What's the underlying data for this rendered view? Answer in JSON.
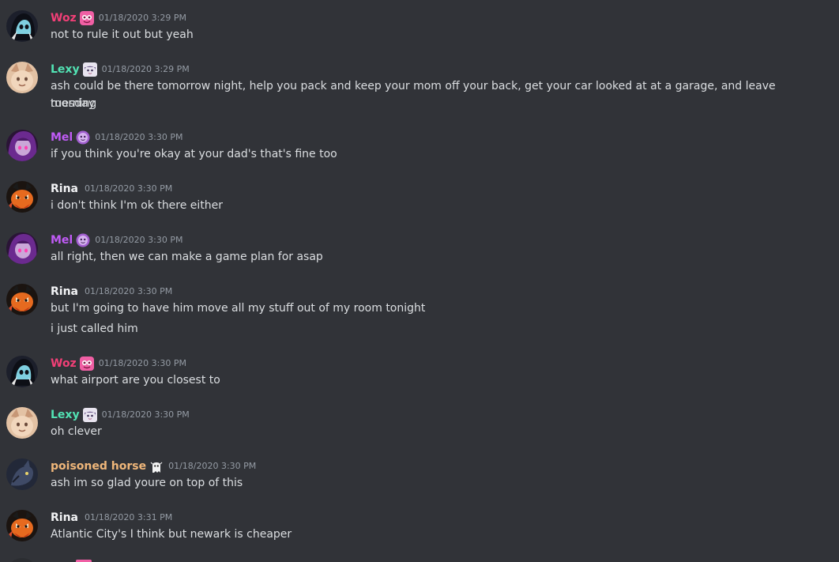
{
  "messages": [
    {
      "user": "Woz",
      "user_color": "#f23f77",
      "badge": "pink-creature-emoji",
      "avatar": "dark-hooded-face-avatar",
      "timestamp": "01/18/2020 3:29 PM",
      "lines": [
        "not to rule it out but yeah"
      ]
    },
    {
      "user": "Lexy",
      "user_color": "#52e3b4",
      "badge": "anime-girl-emoji",
      "avatar": "beige-fox-avatar",
      "timestamp": "01/18/2020 3:29 PM",
      "lines": [
        "ash could be there tomorrow night, help you pack and keep your mom off your back, get your car looked at at a garage, and leave tuesday",
        "morning"
      ]
    },
    {
      "user": "Mel",
      "user_color": "#c05bf6",
      "badge": "purple-face-emoji",
      "avatar": "purple-haired-girl-avatar",
      "timestamp": "01/18/2020 3:30 PM",
      "lines": [
        "if you think you're okay at your dad's that's fine too"
      ]
    },
    {
      "user": "Rina",
      "user_color": "#f2f3f5",
      "badge": "",
      "avatar": "orange-dragon-avatar",
      "timestamp": "01/18/2020 3:30 PM",
      "lines": [
        "i don't think I'm ok there either"
      ]
    },
    {
      "user": "Mel",
      "user_color": "#c05bf6",
      "badge": "purple-face-emoji",
      "avatar": "purple-haired-girl-avatar",
      "timestamp": "01/18/2020 3:30 PM",
      "lines": [
        "all right, then we can make a game plan for asap"
      ]
    },
    {
      "user": "Rina",
      "user_color": "#f2f3f5",
      "badge": "",
      "avatar": "orange-dragon-avatar",
      "timestamp": "01/18/2020 3:30 PM",
      "lines": [
        "but I'm going to have him move all my stuff out of my room tonight",
        "i just called him"
      ]
    },
    {
      "user": "Woz",
      "user_color": "#f23f77",
      "badge": "pink-creature-emoji",
      "avatar": "dark-hooded-face-avatar",
      "timestamp": "01/18/2020 3:30 PM",
      "lines": [
        "what airport are you closest to"
      ]
    },
    {
      "user": "Lexy",
      "user_color": "#52e3b4",
      "badge": "anime-girl-emoji",
      "avatar": "beige-fox-avatar",
      "timestamp": "01/18/2020 3:30 PM",
      "lines": [
        "oh clever"
      ]
    },
    {
      "user": "poisoned horse",
      "user_color": "#f0b77a",
      "badge": "ghost-emoji",
      "avatar": "dark-horse-avatar",
      "timestamp": "01/18/2020 3:30 PM",
      "lines": [
        "ash im so glad youre on top of this"
      ]
    },
    {
      "user": "Rina",
      "user_color": "#f2f3f5",
      "badge": "",
      "avatar": "orange-dragon-avatar",
      "timestamp": "01/18/2020 3:31 PM",
      "lines": [
        "Atlantic City's I think but newark is cheaper"
      ]
    }
  ]
}
